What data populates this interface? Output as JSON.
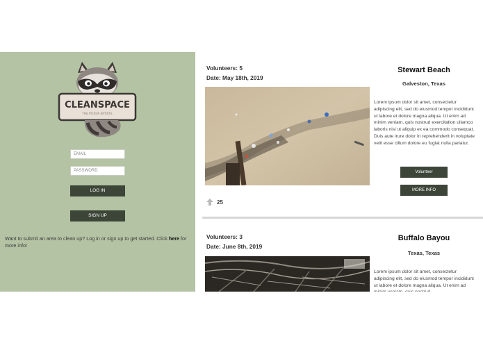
{
  "sidebar": {
    "logo_title": "CLEANSPACE",
    "logo_subtitle": "THE PICKUP ARTISTS",
    "email_placeholder": "EMAIL",
    "password_placeholder": "PASSWORD",
    "login_label": "LOG IN",
    "signup_label": "SIGN UP",
    "info_before": "Want to submit an area to clean up? Log in or sign up to get started. Click ",
    "info_link": "here",
    "info_after": " for more info!"
  },
  "cards": [
    {
      "volunteers": "Volunteers: 5",
      "date": "Date: May 18th, 2019",
      "title": "Stewart Beach",
      "location": "Galveston, Texas",
      "description": "Lorem ipsum dolor sit amet, consectetur adipiscing elit, sed do eiusmod tempor incididunt ut labore et dolore magna aliqua. Ut enim ad minim veniam, quis nostrud exercitation ullamco laboris nisi ut aliquip ex ea commodo consequat. Duis aute irure dolor in reprehenderit in voluptate velit esse cillum dolore eu fugiat nulla pariatur.",
      "volunteer_label": "Volunteer",
      "more_info_label": "MORE INFO",
      "votes": "25"
    },
    {
      "volunteers": "Volunteers: 3",
      "date": "Date: June 8th, 2019",
      "title": "Buffalo Bayou",
      "location": "Texas, Texas",
      "description": "Lorem ipsum dolor sit amet, consectetur adipiscing elit, sed do eiusmod tempor incididunt ut labore et dolore magna aliqua. Ut enim ad minim veniam, quis nostrud"
    }
  ],
  "colors": {
    "sidebar_bg": "#b3c3a3",
    "button_dark": "#3d4538"
  },
  "icons": [
    "raccoon-logo",
    "upvote-arrow-icon"
  ]
}
